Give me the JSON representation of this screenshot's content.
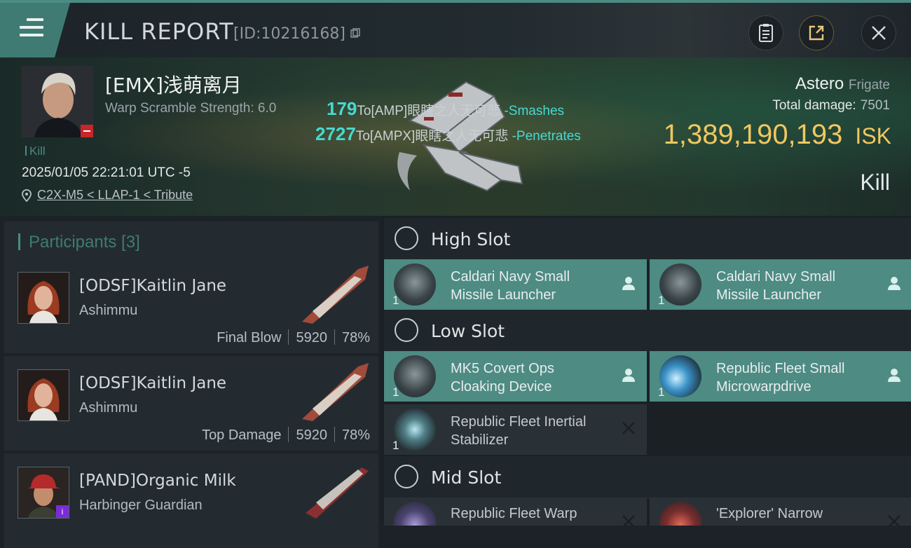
{
  "header": {
    "menu_icon": "menu-icon",
    "title": "KILL REPORT",
    "report_id": "[ID:10216168]",
    "buttons": [
      "clipboard-icon",
      "share-icon",
      "close-icon"
    ]
  },
  "victim": {
    "name": "[EMX]浅萌离月",
    "scramble": "Warp Scramble Strength: 6.0",
    "kill_tag": "Kill",
    "datetime": "2025/01/05 22:21:01 UTC -5",
    "location": "C2X-M5 < LLAP-1 < Tribute"
  },
  "damage_lines": [
    {
      "num": "179",
      "target": "To[AMP]眼瞎之人无可悲",
      "tag": "-Smashes"
    },
    {
      "num": "2727",
      "target": "To[AMPX]眼瞎之人无可悲",
      "tag": "-Penetrates"
    }
  ],
  "ship": {
    "name": "Astero",
    "class": "Frigate",
    "total_damage_label": "Total damage:",
    "total_damage": "7501",
    "isk_value": "1,389,190,193",
    "isk_unit": "ISK",
    "result": "Kill"
  },
  "participants": {
    "header": "Participants [3]",
    "rows": [
      {
        "name": "[ODSF]Kaitlin Jane",
        "ship": "Ashimmu",
        "role": "Final Blow",
        "damage": "5920",
        "percent": "78%"
      },
      {
        "name": "[ODSF]Kaitlin Jane",
        "ship": "Ashimmu",
        "role": "Top Damage",
        "damage": "5920",
        "percent": "78%"
      },
      {
        "name": "[PAND]Organic Milk",
        "ship": "Harbinger Guardian"
      }
    ]
  },
  "slots": {
    "high": {
      "label": "High Slot",
      "items": [
        {
          "line1": "Caldari Navy Small",
          "line2": "Missile Launcher",
          "qty": "1",
          "state": "fitted"
        },
        {
          "line1": "Caldari Navy Small",
          "line2": "Missile Launcher",
          "qty": "1",
          "state": "fitted"
        }
      ]
    },
    "low": {
      "label": "Low Slot",
      "items": [
        {
          "line1": "MK5 Covert Ops",
          "line2": "Cloaking Device",
          "qty": "1",
          "state": "fitted"
        },
        {
          "line1": "Republic Fleet Small",
          "line2": "Microwarpdrive",
          "qty": "1",
          "state": "fitted"
        },
        {
          "line1": "Republic Fleet Inertial",
          "line2": "Stabilizer",
          "qty": "1",
          "state": "destroyed"
        }
      ]
    },
    "mid": {
      "label": "Mid Slot",
      "items": [
        {
          "line1": "Republic Fleet Warp",
          "line2": "",
          "qty": "",
          "state": "destroyed"
        },
        {
          "line1": "'Explorer' Narrow",
          "line2": "",
          "qty": "",
          "state": "destroyed"
        }
      ]
    }
  },
  "colors": {
    "accent": "#4d8b83",
    "isk": "#f0c760",
    "damage": "#46d9d1"
  }
}
